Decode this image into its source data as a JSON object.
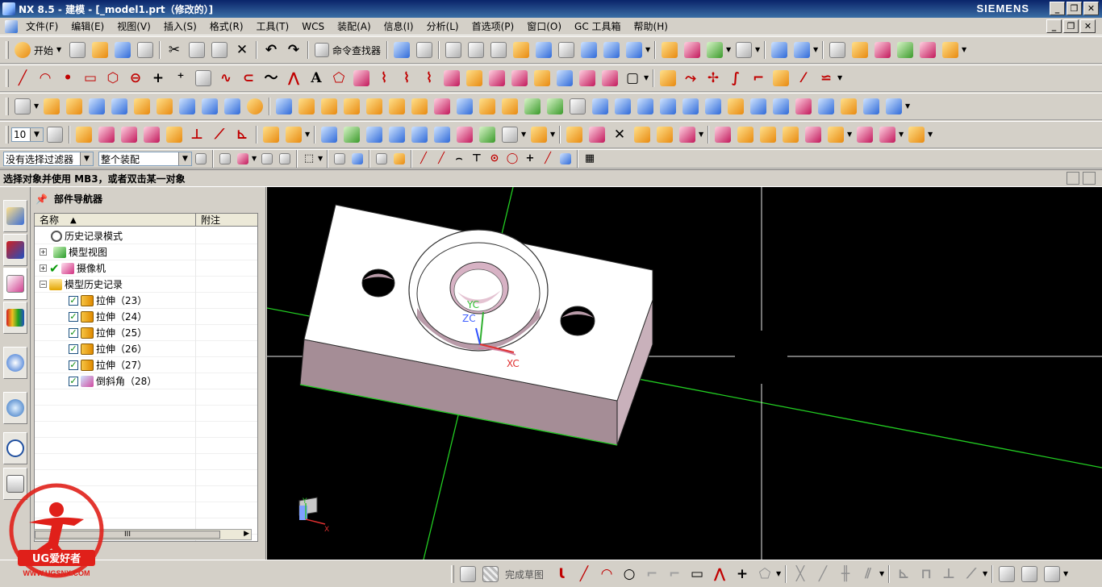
{
  "window": {
    "title": "NX 8.5 - 建模 - [_model1.prt（修改的）]",
    "brand": "SIEMENS",
    "buttons": [
      "_",
      "❐",
      "✕"
    ]
  },
  "menubar": {
    "items": [
      "文件(F)",
      "编辑(E)",
      "视图(V)",
      "插入(S)",
      "格式(R)",
      "工具(T)",
      "WCS",
      "装配(A)",
      "信息(I)",
      "分析(L)",
      "首选项(P)",
      "窗口(O)",
      "GC 工具箱",
      "帮助(H)"
    ],
    "mdi_buttons": [
      "_",
      "❐",
      "✕"
    ]
  },
  "toolbar1": {
    "start_label": "开始",
    "command_finder_label": "命令查找器"
  },
  "toolbar4": {
    "grid_value": "10"
  },
  "selection_bar": {
    "filter_value": "没有选择过滤器",
    "scope_value": "整个装配"
  },
  "cue_line": {
    "text": "选择对象并使用 MB3，或者双击某一对象"
  },
  "navigator": {
    "title": "部件导航器",
    "columns": {
      "name": "名称",
      "notes": "附注"
    },
    "rows": [
      {
        "label": "历史记录模式",
        "kind": "clock",
        "level": 0
      },
      {
        "label": "模型视图",
        "kind": "view",
        "level": 0
      },
      {
        "label": "摄像机",
        "kind": "cam",
        "level": 0
      },
      {
        "label": "模型历史记录",
        "kind": "folder",
        "level": 0
      },
      {
        "label": "拉伸（23）",
        "kind": "extrude",
        "level": 1
      },
      {
        "label": "拉伸（24）",
        "kind": "extrude",
        "level": 1
      },
      {
        "label": "拉伸（25）",
        "kind": "extrude",
        "level": 1
      },
      {
        "label": "拉伸（26）",
        "kind": "extrude",
        "level": 1
      },
      {
        "label": "拉伸（27）",
        "kind": "extrude",
        "level": 1
      },
      {
        "label": "倒斜角（28）",
        "kind": "chamfer",
        "level": 1
      }
    ],
    "scroll_label": "III"
  },
  "graphics": {
    "wcs_labels": {
      "yc": "YC",
      "zc": "ZC",
      "xc": "XC"
    },
    "triad_labels": {
      "y": "Y",
      "x": "X"
    },
    "colors": {
      "background": "#000000",
      "part_top": "#ffffff",
      "part_side": "#a58d96",
      "datum": "#22cc22"
    }
  },
  "bottom_toolbar": {
    "finish_sketch_label": "完成草图"
  },
  "watermark": {
    "brand": "UG爱好者",
    "url": "WWW.UGSNX.COM"
  },
  "icons": {
    "resource_tabs": [
      "assembly-navigator-icon",
      "constraint-navigator-icon",
      "part-navigator-icon",
      "reuse-library-icon",
      "web-browser-icon",
      "history-icon",
      "system-materials-icon",
      "roles-icon"
    ]
  }
}
